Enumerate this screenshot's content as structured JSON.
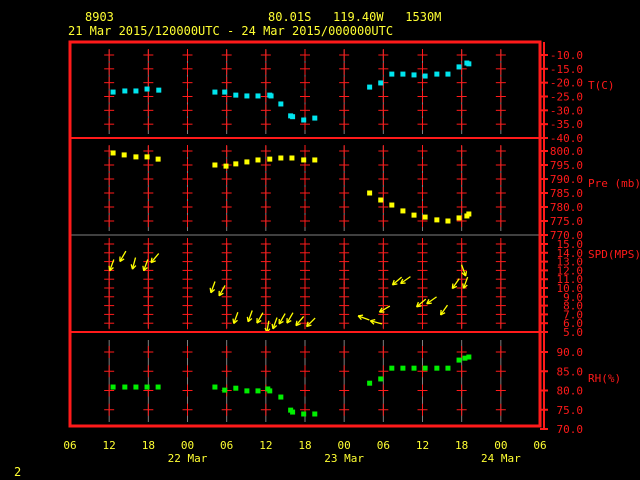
{
  "header": {
    "station": "8903",
    "location": "80.01S   119.40W   1530M",
    "period": "21 Mar 2015/120000UTC - 24 Mar 2015/000000UTC"
  },
  "page_number": "2",
  "colors": {
    "frame": "#ff1a1a",
    "text": "#ffff33",
    "temp": "#00e5ee",
    "pres": "#ffff00",
    "wind": "#ffff00",
    "rh": "#00ee00",
    "grid": "#808080"
  },
  "chart_data": {
    "type": "line",
    "x_unit": "hours since 21 Mar 06UTC",
    "x_ticks": [
      "06",
      "12",
      "18",
      "00",
      "06",
      "12",
      "18",
      "00",
      "06",
      "12",
      "18",
      "00",
      "06"
    ],
    "x_dates": [
      {
        "label": "22 Mar",
        "tick": 3
      },
      {
        "label": "23 Mar",
        "tick": 7
      },
      {
        "label": "24 Mar",
        "tick": 11
      }
    ],
    "panels": [
      {
        "name": "T(C)",
        "ticks": [
          "-10.0",
          "-15.0",
          "-20.0",
          "-25.0",
          "-30.0",
          "-35.0",
          "-40.0"
        ],
        "ylim": [
          -40,
          -10
        ],
        "points": [
          [
            6.6,
            -23.4
          ],
          [
            8.4,
            -23
          ],
          [
            10.1,
            -23
          ],
          [
            11.8,
            -22.3
          ],
          [
            13.6,
            -22.7
          ],
          [
            22.2,
            -23.4
          ],
          [
            23.7,
            -23.4
          ],
          [
            25.4,
            -24.5
          ],
          [
            27.1,
            -24.8
          ],
          [
            28.8,
            -24.8
          ],
          [
            30.6,
            -24.5
          ],
          [
            30.8,
            -24.8
          ],
          [
            32.3,
            -27.7
          ],
          [
            33.8,
            -32
          ],
          [
            34.1,
            -32.3
          ],
          [
            35.8,
            -33.5
          ],
          [
            37.5,
            -32.8
          ],
          [
            45.9,
            -21.6
          ],
          [
            47.6,
            -20.1
          ],
          [
            49.3,
            -16.9
          ],
          [
            51,
            -16.9
          ],
          [
            52.7,
            -17.2
          ],
          [
            54.4,
            -17.6
          ],
          [
            56.2,
            -16.9
          ],
          [
            57.9,
            -16.9
          ],
          [
            59.6,
            -14.3
          ],
          [
            60.8,
            -12.9
          ],
          [
            61.1,
            -13.2
          ]
        ]
      },
      {
        "name": "Pre (mb)",
        "ticks": [
          "800.0",
          "795.0",
          "790.0",
          "785.0",
          "780.0",
          "775.0",
          "770.0"
        ],
        "ylim": [
          770,
          804
        ],
        "points": [
          [
            6.6,
            799.3
          ],
          [
            8.3,
            798.6
          ],
          [
            10.1,
            797.9
          ],
          [
            11.8,
            797.9
          ],
          [
            13.5,
            797.1
          ],
          [
            22.2,
            795
          ],
          [
            23.9,
            794.6
          ],
          [
            25.4,
            795.4
          ],
          [
            27.1,
            796.1
          ],
          [
            28.8,
            796.8
          ],
          [
            30.6,
            797.1
          ],
          [
            32.3,
            797.5
          ],
          [
            33.999,
            797.5
          ],
          [
            35.8,
            796.8
          ],
          [
            37.5,
            796.8
          ],
          [
            45.9,
            785
          ],
          [
            47.6,
            782.5
          ],
          [
            49.3,
            780.7
          ],
          [
            51,
            778.6
          ],
          [
            52.7,
            777.1
          ],
          [
            54.4,
            776.4
          ],
          [
            56.2,
            775.4
          ],
          [
            57.9,
            775
          ],
          [
            59.6,
            776.1
          ],
          [
            60.8,
            776.8
          ],
          [
            61.1,
            777.5
          ]
        ]
      },
      {
        "name": "SPD(MPS)",
        "ticks": [
          "15.0",
          "14.0",
          "13.0",
          "12.0",
          "11.0",
          "10.0",
          "9.0",
          "8.0",
          "7.0",
          "6.0",
          "5.0"
        ],
        "ylim": [
          5,
          16
        ],
        "points": [
          [
            6.4,
            12.6,
            200
          ],
          [
            8.1,
            13.6,
            210
          ],
          [
            9.8,
            12.8,
            195
          ],
          [
            11.6,
            12.6,
            200
          ],
          [
            13,
            13.4,
            220
          ],
          [
            21.9,
            10.1,
            200
          ],
          [
            23.3,
            9.7,
            210
          ],
          [
            25.4,
            6.6,
            200
          ],
          [
            27.6,
            6.8,
            200
          ],
          [
            29.1,
            6.6,
            210
          ],
          [
            30.3,
            5.6,
            190
          ],
          [
            31.4,
            6.0,
            200
          ],
          [
            32.5,
            6.5,
            210
          ],
          [
            33.7,
            6.6,
            210
          ],
          [
            35.2,
            6.25,
            220
          ],
          [
            36.9,
            6.1,
            225
          ],
          [
            45,
            6.6,
            290
          ],
          [
            46.9,
            6.1,
            285
          ],
          [
            48.2,
            7.6,
            240
          ],
          [
            50.1,
            10.8,
            230
          ],
          [
            51.4,
            10.9,
            235
          ],
          [
            53.8,
            8.3,
            230
          ],
          [
            55.4,
            8.6,
            235
          ],
          [
            57.3,
            7.5,
            215
          ],
          [
            59.1,
            10.5,
            215
          ],
          [
            60.3,
            12.0,
            160
          ],
          [
            60.6,
            10.6,
            200
          ]
        ]
      },
      {
        "name": "RH(%)",
        "ticks": [
          "90.0",
          "85.0",
          "80.0",
          "75.0",
          "70.0"
        ],
        "ylim": [
          70,
          90
        ],
        "points": [
          [
            6.6,
            80.9
          ],
          [
            8.4,
            80.9
          ],
          [
            10.1,
            80.9
          ],
          [
            11.8,
            80.9
          ],
          [
            13.5,
            80.9
          ],
          [
            22.2,
            80.9
          ],
          [
            23.7,
            80.1
          ],
          [
            25.4,
            80.6
          ],
          [
            27.1,
            79.9
          ],
          [
            28.8,
            79.9
          ],
          [
            30.3,
            80.4
          ],
          [
            30.6,
            79.9
          ],
          [
            32.3,
            78.3
          ],
          [
            33.8,
            74.9
          ],
          [
            34.1,
            74.4
          ],
          [
            35.8,
            73.9
          ],
          [
            37.5,
            73.9
          ],
          [
            45.9,
            81.9
          ],
          [
            47.6,
            83
          ],
          [
            49.3,
            85.8
          ],
          [
            51,
            85.8
          ],
          [
            52.7,
            85.8
          ],
          [
            54.4,
            85.8
          ],
          [
            56.2,
            85.8
          ],
          [
            57.9,
            85.8
          ],
          [
            59.6,
            87.9
          ],
          [
            60.5,
            88.4
          ],
          [
            61.1,
            88.7
          ]
        ]
      }
    ]
  }
}
